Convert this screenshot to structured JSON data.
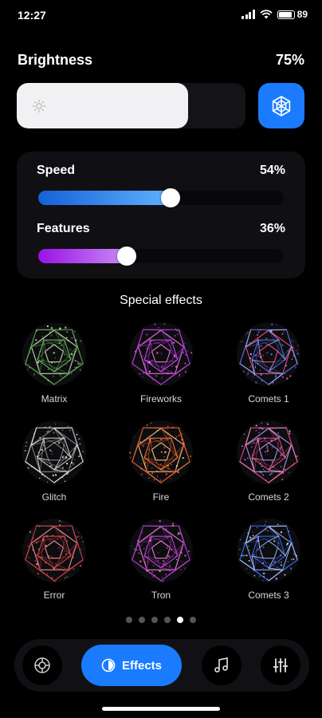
{
  "status": {
    "time": "12:27",
    "battery": "89"
  },
  "brightness": {
    "title": "Brightness",
    "value_text": "75%",
    "level": 0.75,
    "button_icon": "snowflake-icon",
    "accent": "#1a7bff"
  },
  "sliders": [
    {
      "label": "Speed",
      "value_text": "54%",
      "level": 0.54,
      "gradient": [
        "#1560d8",
        "#5fb2ff"
      ]
    },
    {
      "label": "Features",
      "value_text": "36%",
      "level": 0.36,
      "gradient": [
        "#9b11e6",
        "#c88cf5"
      ]
    }
  ],
  "effects": {
    "heading": "Special effects",
    "items": [
      {
        "label": "Matrix",
        "colors": [
          "#76c26a",
          "#d9e8c3",
          "#3c7a3a"
        ]
      },
      {
        "label": "Fireworks",
        "colors": [
          "#d24cf0",
          "#ff7ae6",
          "#8b2ab8"
        ]
      },
      {
        "label": "Comets 1",
        "colors": [
          "#5e6fe0",
          "#ff4d8a",
          "#c0c7ff"
        ]
      },
      {
        "label": "Glitch",
        "colors": [
          "#cfcfcf",
          "#8d8d8d",
          "#ffffff"
        ]
      },
      {
        "label": "Fire",
        "colors": [
          "#ff7a3a",
          "#ffd08a",
          "#c8401f"
        ]
      },
      {
        "label": "Comets 2",
        "colors": [
          "#e0488a",
          "#b4a0ff",
          "#ff9ec7"
        ]
      },
      {
        "label": "Error",
        "colors": [
          "#e05050",
          "#ff9a9a",
          "#a12c2c"
        ]
      },
      {
        "label": "Tron",
        "colors": [
          "#d24ce0",
          "#ff8adf",
          "#8a2aa8"
        ]
      },
      {
        "label": "Comets 3",
        "colors": [
          "#3d6cf0",
          "#8fb0ff",
          "#e8eeff"
        ]
      }
    ]
  },
  "pager": {
    "count": 6,
    "active": 4
  },
  "nav": {
    "effects_label": "Effects",
    "items": [
      "palette-icon",
      "effects-icon",
      "music-note-icon",
      "equalizer-sliders-icon"
    ]
  }
}
